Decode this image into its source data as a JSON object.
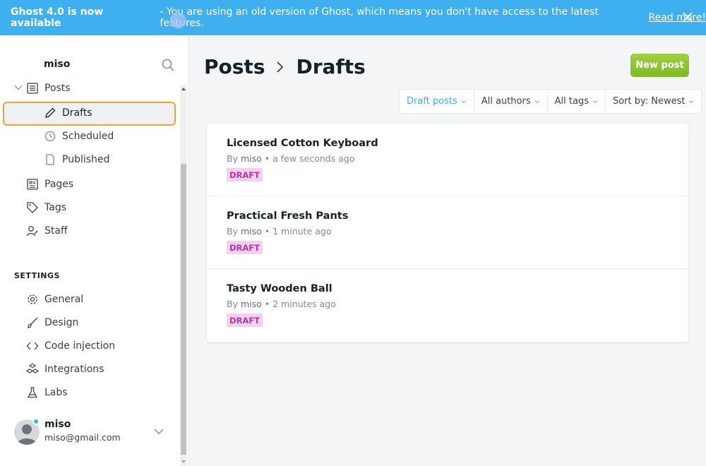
{
  "banner": {
    "headline": "Ghost 4.0 is now available",
    "message": "- You are using an old version of Ghost, which means you don't have access to the latest features.",
    "link": "Read more!",
    "bg_color": "#3eb0ef"
  },
  "sidebar": {
    "site_name": "miso",
    "posts_label": "Posts",
    "sub_items": [
      {
        "label": "Drafts",
        "icon": "pencil-icon",
        "selected": true
      },
      {
        "label": "Scheduled",
        "icon": "clock-icon"
      },
      {
        "label": "Published",
        "icon": "page-icon"
      }
    ],
    "nav_items": [
      {
        "label": "Pages",
        "icon": "pages-icon"
      },
      {
        "label": "Tags",
        "icon": "tag-icon"
      },
      {
        "label": "Staff",
        "icon": "staff-icon"
      }
    ],
    "settings_heading": "SETTINGS",
    "settings_items": [
      {
        "label": "General",
        "icon": "gear-icon"
      },
      {
        "label": "Design",
        "icon": "brush-icon"
      },
      {
        "label": "Code injection",
        "icon": "code-icon"
      },
      {
        "label": "Integrations",
        "icon": "integrations-icon"
      },
      {
        "label": "Labs",
        "icon": "flask-icon"
      }
    ],
    "user": {
      "name": "miso",
      "email": "miso@gmail.com"
    }
  },
  "main": {
    "breadcrumb_root": "Posts",
    "breadcrumb_current": "Drafts",
    "new_post_label": "New post",
    "accent_color": "#9fcf3f",
    "filters": [
      {
        "label": "Draft posts",
        "active": true
      },
      {
        "label": "All authors"
      },
      {
        "label": "All tags"
      },
      {
        "label": "Sort by: Newest"
      }
    ],
    "posts": [
      {
        "title": "Licensed Cotton Keyboard",
        "by": "By",
        "author": "miso",
        "time": "• a few seconds ago",
        "status": "DRAFT"
      },
      {
        "title": "Practical Fresh Pants",
        "by": "By",
        "author": "miso",
        "time": "• 1 minute ago",
        "status": "DRAFT"
      },
      {
        "title": "Tasty Wooden Ball",
        "by": "By",
        "author": "miso",
        "time": "• 2 minutes ago",
        "status": "DRAFT"
      }
    ],
    "draft_badge_color": "#b535a8"
  }
}
